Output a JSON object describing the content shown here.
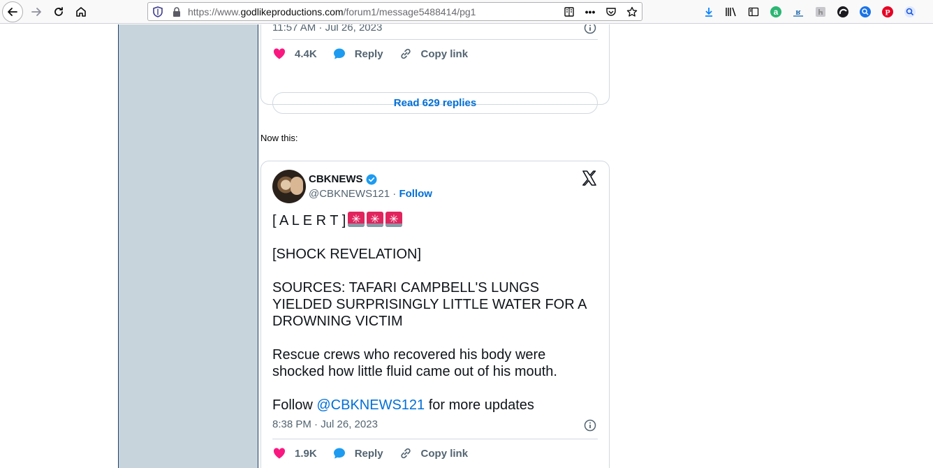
{
  "browser": {
    "url_prefix": "https://www.",
    "url_domain": "godlikeproductions.com",
    "url_path": "/forum1/message5488414/pg1",
    "menu_dots": "•••"
  },
  "colors": {
    "like": "#f91880",
    "reply": "#1d9bf0",
    "link": "#006fd6",
    "sidebar": "#c8d4dc"
  },
  "tweet1": {
    "timestamp": "11:57 AM · Jul 26, 2023",
    "likes": "4.4K",
    "reply_label": "Reply",
    "copy_label": "Copy link",
    "read_replies": "Read 629 replies"
  },
  "between_text": "Now this:",
  "tweet2": {
    "display_name": "CBKNEWS",
    "handle": "@CBKNEWS121",
    "separator": " · ",
    "follow_label": "Follow",
    "alert_text": "[ A L E R T ]",
    "line2": "[SHOCK REVELATION]",
    "line3": "SOURCES: TAFARI CAMPBELL'S LUNGS YIELDED SURPRISINGLY LITTLE WATER FOR A DROWNING VICTIM",
    "line4": "Rescue crews who recovered his body were shocked how little fluid came out of his mouth.",
    "follow_prefix": "Follow ",
    "follow_mention": "@CBKNEWS121",
    "follow_suffix": " for more updates",
    "timestamp": "8:38 PM · Jul 26, 2023",
    "likes": "1.9K",
    "reply_label": "Reply",
    "copy_label": "Copy link"
  }
}
